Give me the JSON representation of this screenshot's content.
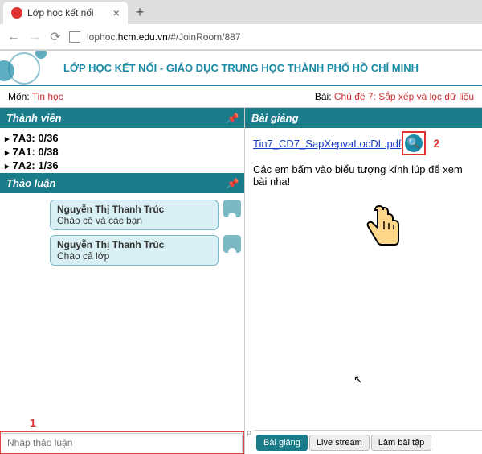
{
  "browser": {
    "tab_title": "Lớp học kết nối",
    "url_display_pre": "lophoc.",
    "url_display_domain": "hcm.edu.vn",
    "url_display_post": "/#/JoinRoom/887"
  },
  "banner": {
    "title": "LỚP HỌC KẾT NỐI  -  GIÁO DỤC TRUNG HỌC THÀNH PHỐ HỒ CHÍ MINH"
  },
  "info": {
    "subject_label": "Môn: ",
    "subject_value": "Tin học",
    "lesson_label": "Bài: ",
    "lesson_value": "Chủ đề 7: Sắp xếp và lọc dữ liệu"
  },
  "panels": {
    "members_title": "Thành viên",
    "discuss_title": "Thảo luận",
    "lecture_title": "Bài giảng"
  },
  "members": [
    {
      "label": "7A3: 0/36"
    },
    {
      "label": "7A1: 0/38"
    },
    {
      "label": "7A2: 1/36"
    }
  ],
  "chats": [
    {
      "name": "Nguyễn Thị Thanh Trúc",
      "text": "Chào cô và các bạn"
    },
    {
      "name": "Nguyễn Thị Thanh Trúc",
      "text": "Chào cả lớp"
    }
  ],
  "chat_input": {
    "placeholder": "Nhập thảo luận"
  },
  "lecture": {
    "file_link": "Tin7_CD7_SapXepvaLocDL.pdf",
    "instruction": "Các em bấm vào biểu tượng kính lúp để xem bài nha!"
  },
  "bottom_tabs": [
    "Bài giảng",
    "Live stream",
    "Làm bài tập"
  ],
  "callouts": {
    "one": "1",
    "two": "2"
  },
  "p_letter": "P"
}
